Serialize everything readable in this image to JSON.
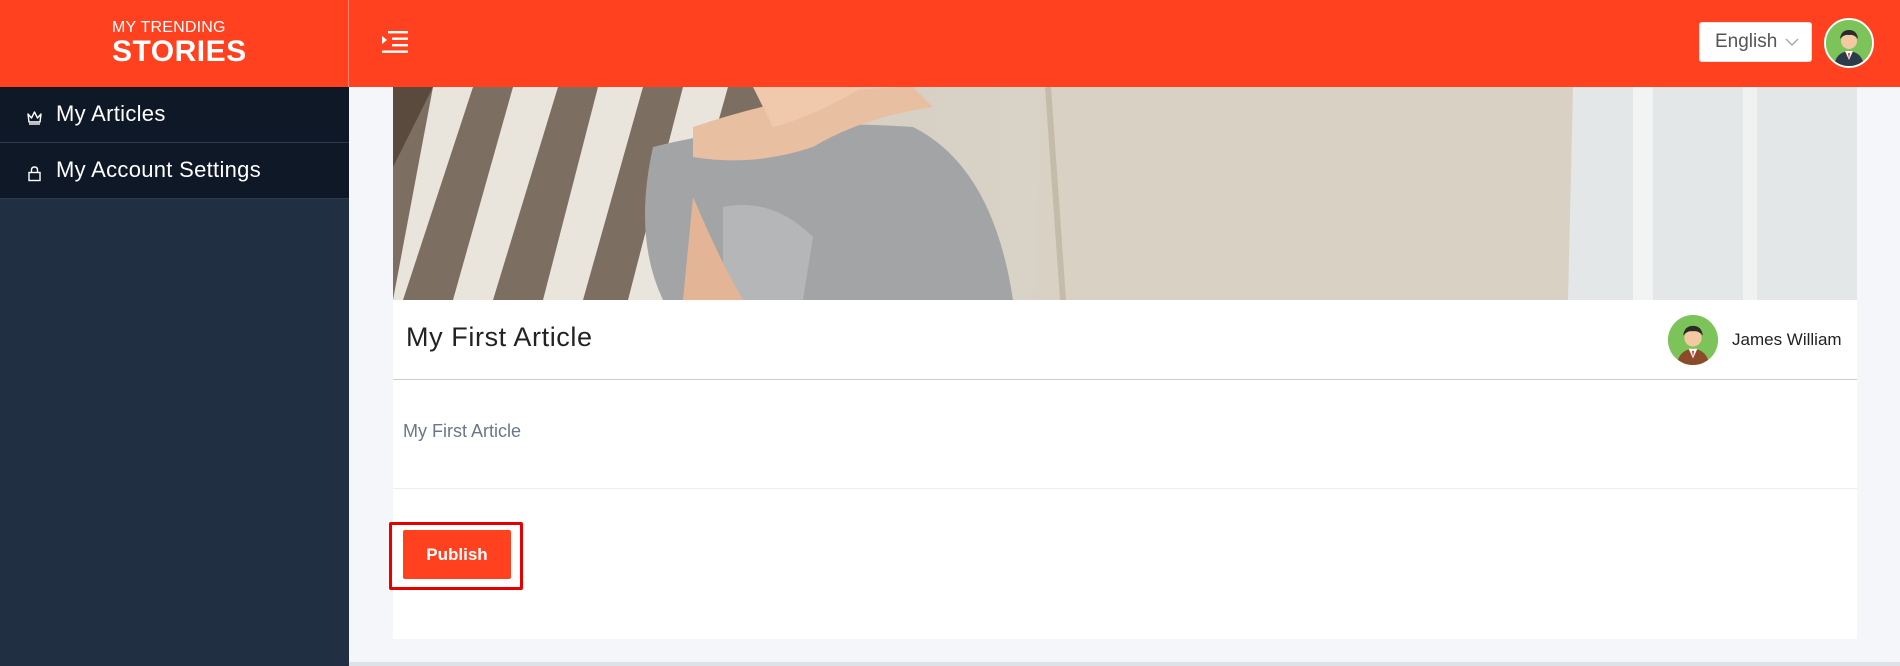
{
  "header": {
    "brand_top": "MY TRENDING",
    "brand_bottom": "STORIES",
    "menu_icon": "indent-menu-icon",
    "language": "English",
    "accent_color": "#ff4120"
  },
  "sidebar": {
    "items": [
      {
        "label": "My Articles",
        "icon": "crown-icon"
      },
      {
        "label": "My Account Settings",
        "icon": "lock-icon"
      }
    ]
  },
  "article": {
    "title": "My First Article",
    "author": "James William",
    "body": "My First Article",
    "publish_label": "Publish"
  }
}
